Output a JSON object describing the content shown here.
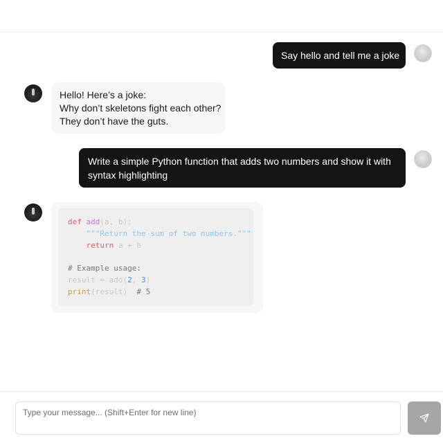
{
  "composer": {
    "placeholder": "Type your message... (Shift+Enter for new line)",
    "send_icon": "send-icon"
  },
  "messages": [
    {
      "role": "user",
      "text": "Say hello and tell me a joke"
    },
    {
      "role": "assistant",
      "lines": [
        "Hello! Here’s a joke:",
        "Why don’t skeletons fight each other?",
        "They don’t have the guts."
      ]
    },
    {
      "role": "user",
      "lines": [
        "Write a simple Python function that adds two numbers and show it with",
        "syntax highlighting"
      ]
    },
    {
      "role": "assistant",
      "type": "code",
      "language": "python",
      "code": {
        "kw_def": "def",
        "fn_name": "add",
        "params": "(a, b):",
        "docstring": "\"\"\"Return the sum of two numbers.\"\"\"",
        "kw_return": "return",
        "return_expr": "a + b",
        "comment": "# Example usage:",
        "result_lhs": "result = add(",
        "num_a": "2",
        "comma": ", ",
        "num_b": "3",
        "close": ")",
        "print_kw": "print",
        "print_args": "(result)",
        "print_comment": "# 5"
      }
    }
  ],
  "colors": {
    "user_bubble": "#141414",
    "assistant_bubble": "#f6f6f6",
    "send_button": "#a6a6a6"
  }
}
